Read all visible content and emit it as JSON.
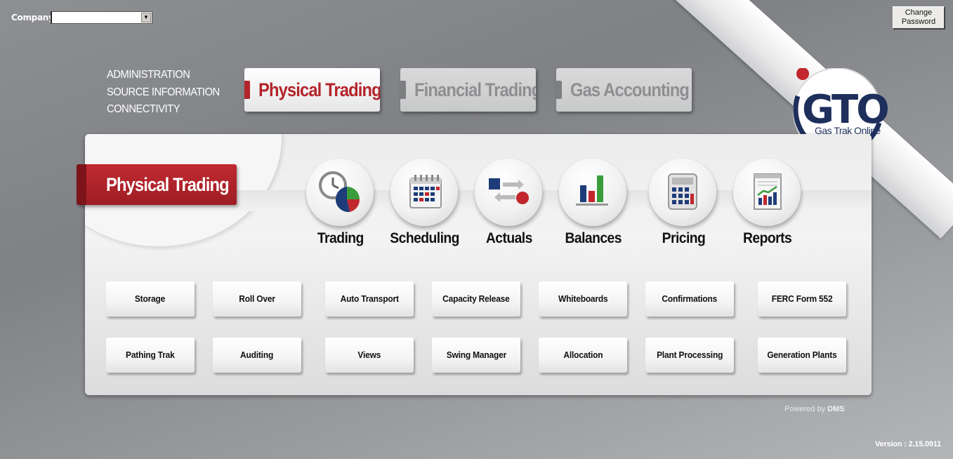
{
  "header": {
    "company_label": "Company",
    "company_value": "",
    "change_password_label": "Change\nPassword"
  },
  "admin_links": [
    "ADMINISTRATION",
    "SOURCE INFORMATION",
    "CONNECTIVITY"
  ],
  "tabs": [
    {
      "label": "Physical Trading",
      "active": true
    },
    {
      "label": "Financial Trading",
      "active": false
    },
    {
      "label": "Gas Accounting",
      "active": false
    }
  ],
  "logo": {
    "text": "GTO",
    "subtitle": "Gas Trak Online"
  },
  "section_title": "Physical Trading",
  "modules": [
    {
      "label": "Trading",
      "icon": "clock-pie-icon"
    },
    {
      "label": "Scheduling",
      "icon": "calendar-icon"
    },
    {
      "label": "Actuals",
      "icon": "transfer-icon"
    },
    {
      "label": "Balances",
      "icon": "bar-chart-icon"
    },
    {
      "label": "Pricing",
      "icon": "calculator-icon"
    },
    {
      "label": "Reports",
      "icon": "report-icon"
    }
  ],
  "buttons_row1": [
    "Storage",
    "Roll Over",
    "Auto Transport",
    "Capacity Release",
    "Whiteboards",
    "Confirmations",
    "FERC Form 552"
  ],
  "buttons_row2": [
    "Pathing Trak",
    "Auditing",
    "Views",
    "Swing Manager",
    "Allocation",
    "Plant Processing",
    "Generation Plants"
  ],
  "footer": {
    "powered_by": "Powered by",
    "powered_brand": "DMS",
    "version": "Version : 2.15.0911"
  },
  "colors": {
    "accent_red": "#b3252b",
    "logo_navy": "#1e2f5c",
    "inactive_tab_text": "#8e8f91"
  }
}
